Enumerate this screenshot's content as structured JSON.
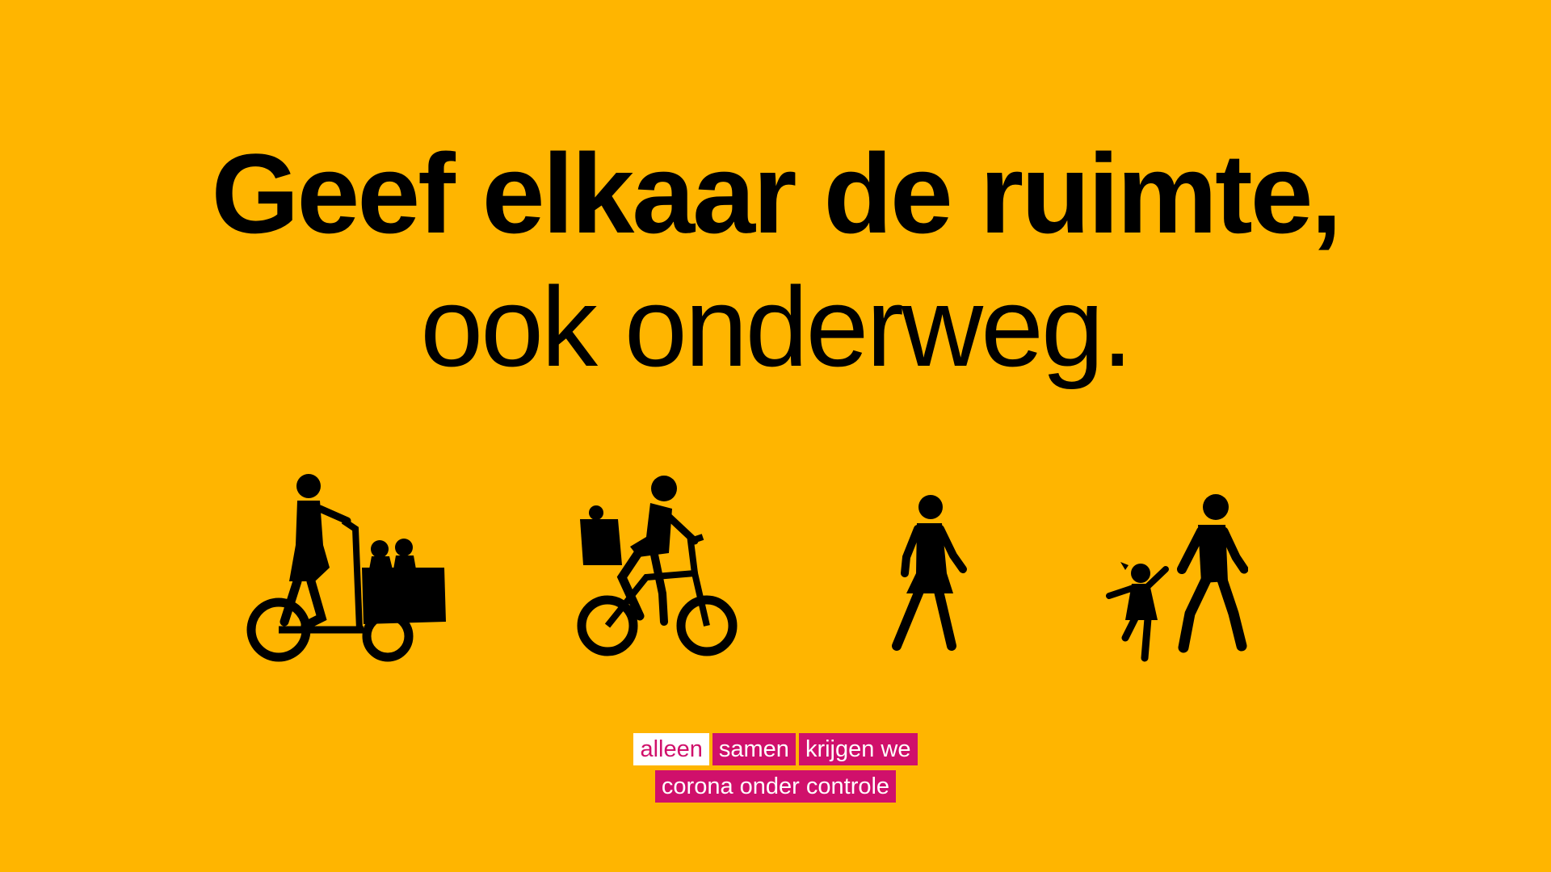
{
  "headline": {
    "line1": "Geef elkaar de ruimte,",
    "line2": "ook onderweg."
  },
  "icons": [
    {
      "name": "cargo-bike-icon"
    },
    {
      "name": "bicycle-child-seat-icon"
    },
    {
      "name": "pedestrian-icon"
    },
    {
      "name": "adult-child-walking-icon"
    }
  ],
  "campaign": {
    "word1": "alleen",
    "word2": "samen",
    "word3": "krijgen we",
    "line2": "corona onder controle"
  },
  "colors": {
    "background": "#FFB500",
    "text": "#000000",
    "campaign_magenta": "#D0106B",
    "campaign_white": "#FFFFFF"
  }
}
